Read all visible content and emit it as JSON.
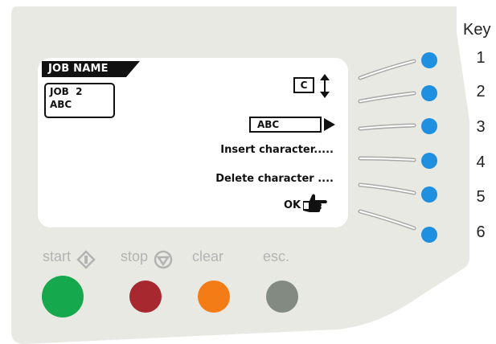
{
  "screen": {
    "tab_title": "JOB NAME",
    "job_line1": "JOB  2",
    "job_line2": "ABC",
    "char_selector": "C",
    "edit_field": "ABC",
    "options": [
      "Insert character.....",
      "Delete character ...."
    ],
    "ok_label": "OK"
  },
  "soft_keys": {
    "header": "Key",
    "labels": [
      "1",
      "2",
      "3",
      "4",
      "5",
      "6"
    ]
  },
  "buttons": {
    "start": "start",
    "stop": "stop",
    "clear": "clear",
    "esc": "esc."
  },
  "colors": {
    "panel": "#e9e9e4",
    "key_dot": "#1f8fe0",
    "start": "#16a84c",
    "stop": "#a7282f",
    "clear": "#f47c16",
    "esc": "#838a82"
  }
}
